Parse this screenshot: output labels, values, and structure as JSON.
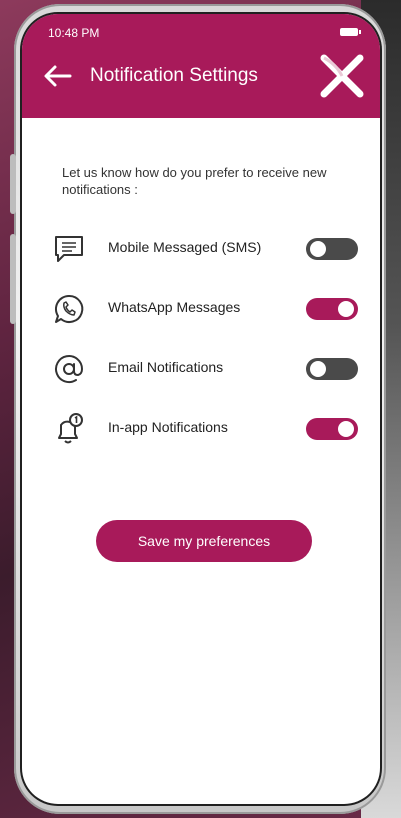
{
  "status_bar": {
    "time": "10:48 PM",
    "battery_icon": "battery-icon"
  },
  "header": {
    "title": "Notification Settings",
    "back_icon": "arrow-left-icon",
    "logo_icon": "x-logo-icon"
  },
  "intro": "Let us know how do you prefer to receive new notifications :",
  "options": [
    {
      "label": "Mobile Messaged (SMS)",
      "icon": "sms-icon",
      "enabled": false
    },
    {
      "label": "WhatsApp Messages",
      "icon": "whatsapp-icon",
      "enabled": true
    },
    {
      "label": "Email Notifications",
      "icon": "at-icon",
      "enabled": false
    },
    {
      "label": "In-app Notifications",
      "icon": "bell-icon",
      "enabled": true
    }
  ],
  "save_label": "Save my preferences",
  "colors": {
    "brand": "#a81a5a",
    "toggle_off": "#4a4a4a"
  }
}
